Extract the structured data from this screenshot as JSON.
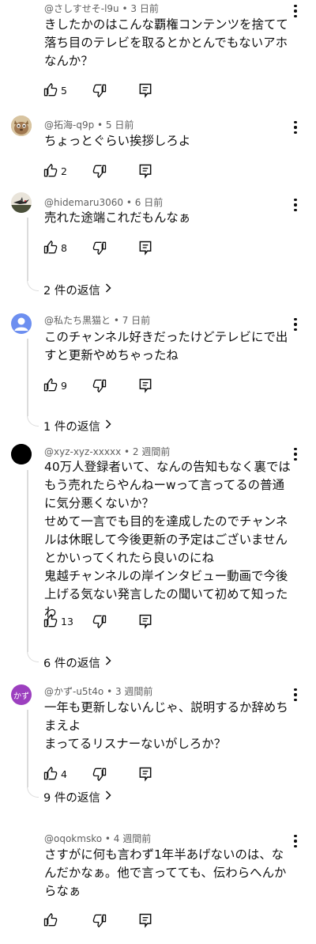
{
  "comments": [
    {
      "author": "@さしすせそ-l9u",
      "time": "3 日前",
      "text": "きしたかのはこんな覇権コンテンツを捨てて落ち目のテレビを取るとかとんでもないアホなんか？",
      "likes": "5",
      "avatar": "none"
    },
    {
      "author": "@拓海-q9p",
      "time": "5 日前",
      "text": "ちょっとぐらい挨拶しろよ",
      "likes": "2",
      "avatar": "cat-photo"
    },
    {
      "author": "@hidemaru3060",
      "time": "6 日前",
      "text": "売れた途端これだもんなぁ",
      "likes": "8",
      "avatar": "bird-photo",
      "replies": "2 件の返信"
    },
    {
      "author": "@私たち黒猫と",
      "time": "7 日前",
      "text": "このチャンネル好きだったけどテレビにで出すと更新やめちゃったね",
      "likes": "9",
      "avatar": "default-person",
      "replies": "1 件の返信"
    },
    {
      "author": "@xyz-xyz-xxxxx",
      "time": "2 週間前",
      "text": "40万人登録者いて、なんの告知もなく裏ではもう売れたらやんねーwって言ってるの普通に気分悪くないか？\nせめて一言でも目的を達成したのでチャンネルは休眠して今後更新の予定はございませんとかいってくれたら良いのにね\n鬼越チャンネルの岸インタビュー動画で今後上げる気ない発言したの聞いて初めて知ったわ",
      "likes": "13",
      "avatar": "black-circle",
      "replies": "6 件の返信"
    },
    {
      "author": "@かず-u5t4o",
      "time": "3 週間前",
      "text": "一年も更新しないんじゃ、説明するか辞めちまえよ\nまってるリスナーないがしろか？",
      "likes": "4",
      "avatar": "initials",
      "avatar_text": "かず",
      "replies": "9 件の返信"
    },
    {
      "author": "@oqokmsko",
      "time": "4 週間前",
      "text": "さすがに何も言わず1年半あげないのは、なんだかなぁ。他で言ってても、伝わらへんからなぁ",
      "likes": "",
      "avatar": "none"
    }
  ],
  "colors": {
    "meta": "#606060",
    "thread_line": "#dcdcdc",
    "avatar_purple": "#9c3fbf",
    "avatar_default_bg": "#6d8ff0"
  },
  "icons": [
    "thumb-up-icon",
    "thumb-down-icon",
    "reply-icon",
    "more-vert-icon",
    "chevron-right-icon"
  ]
}
